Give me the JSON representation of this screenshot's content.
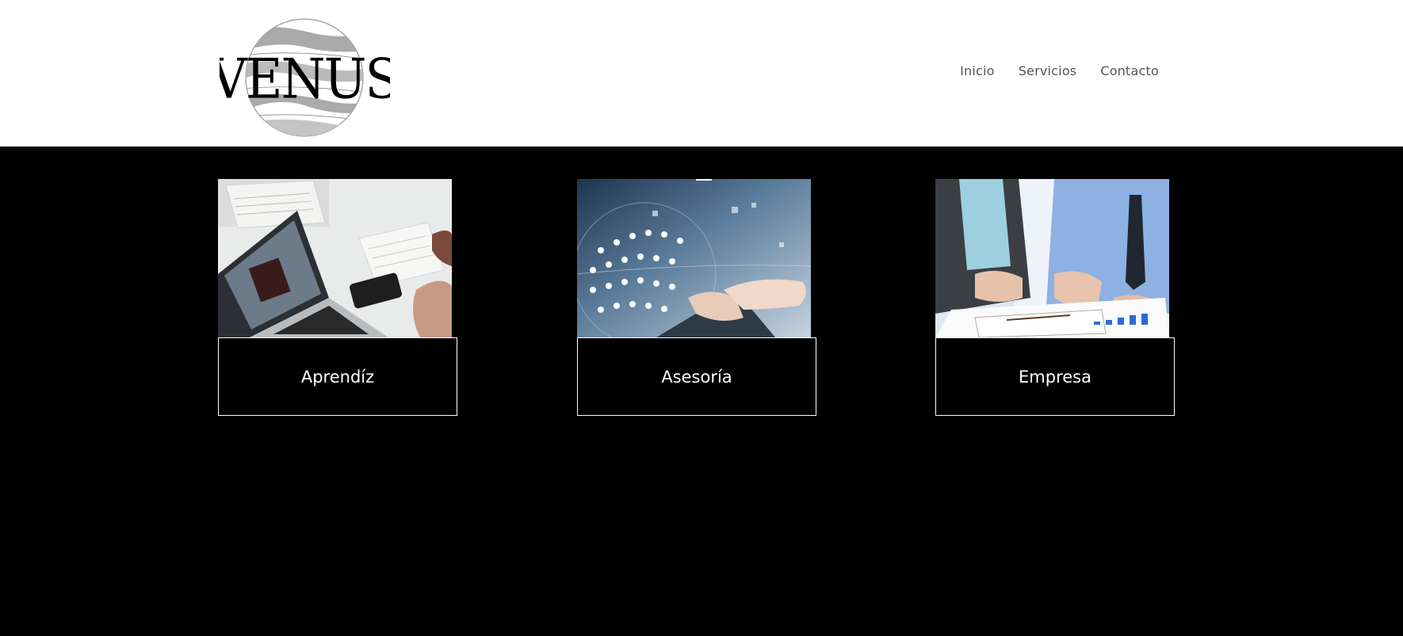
{
  "header": {
    "logo_text": "VENUS",
    "nav": [
      "Inicio",
      "Servicios",
      "Contacto"
    ]
  },
  "services": [
    {
      "label": "Aprendíz",
      "image": "laptop-study-photo"
    },
    {
      "label": "Asesoría",
      "image": "digital-network-photo"
    },
    {
      "label": "Empresa",
      "image": "business-meeting-photo"
    }
  ],
  "colors": {
    "background": "#000000",
    "header_bg": "#ffffff",
    "nav_text": "#555555",
    "card_text": "#ffffff"
  }
}
